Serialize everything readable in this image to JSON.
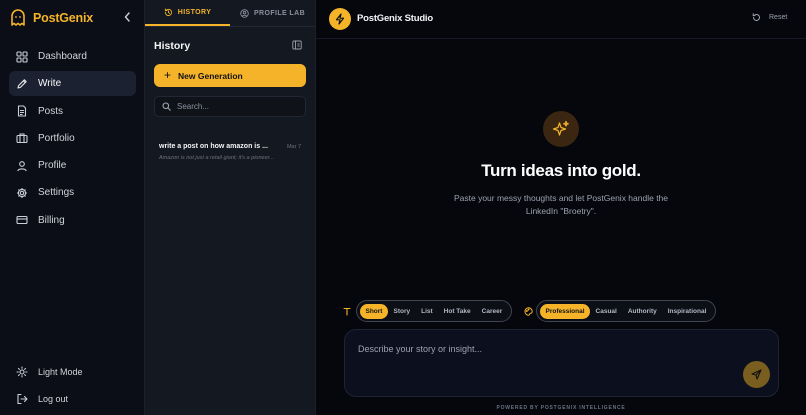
{
  "brand": {
    "name": "PostGenix",
    "accent": "#f5b32a"
  },
  "sidebar": {
    "items": [
      {
        "label": "Dashboard",
        "icon": "grid-icon",
        "active": false
      },
      {
        "label": "Write",
        "icon": "pen-icon",
        "active": true
      },
      {
        "label": "Posts",
        "icon": "document-icon",
        "active": false
      },
      {
        "label": "Portfolio",
        "icon": "briefcase-icon",
        "active": false
      },
      {
        "label": "Profile",
        "icon": "user-icon",
        "active": false
      },
      {
        "label": "Settings",
        "icon": "gear-icon",
        "active": false
      },
      {
        "label": "Billing",
        "icon": "credit-card-icon",
        "active": false
      }
    ],
    "bottom": [
      {
        "label": "Light Mode",
        "icon": "sun-icon"
      },
      {
        "label": "Log out",
        "icon": "logout-icon"
      }
    ]
  },
  "history_panel": {
    "tabs": [
      {
        "label": "HISTORY",
        "icon": "history-icon",
        "active": true
      },
      {
        "label": "PROFILE LAB",
        "icon": "user-circle-icon",
        "active": false
      }
    ],
    "title": "History",
    "new_button": "New Generation",
    "search_placeholder": "Search...",
    "items": [
      {
        "title": "write a post on how amazon is ...",
        "date": "Mar 7",
        "preview": "Amazon is not just a retail giant; it's a pioneer..."
      }
    ]
  },
  "main": {
    "studio_name": "PostGenix Studio",
    "reset_label": "Reset",
    "hero_title": "Turn ideas into gold.",
    "hero_subtitle": "Paste your messy thoughts and let PostGenix handle the LinkedIn \"Broetry\".",
    "formats": {
      "options": [
        "Short",
        "Story",
        "List",
        "Hot Take",
        "Career"
      ],
      "selected": "Short"
    },
    "tones": {
      "options": [
        "Professional",
        "Casual",
        "Authority",
        "Inspirational"
      ],
      "selected": "Professional"
    },
    "input_placeholder": "Describe your story or insight...",
    "footer": "POWERED BY POSTGENIX INTELLIGENCE"
  }
}
